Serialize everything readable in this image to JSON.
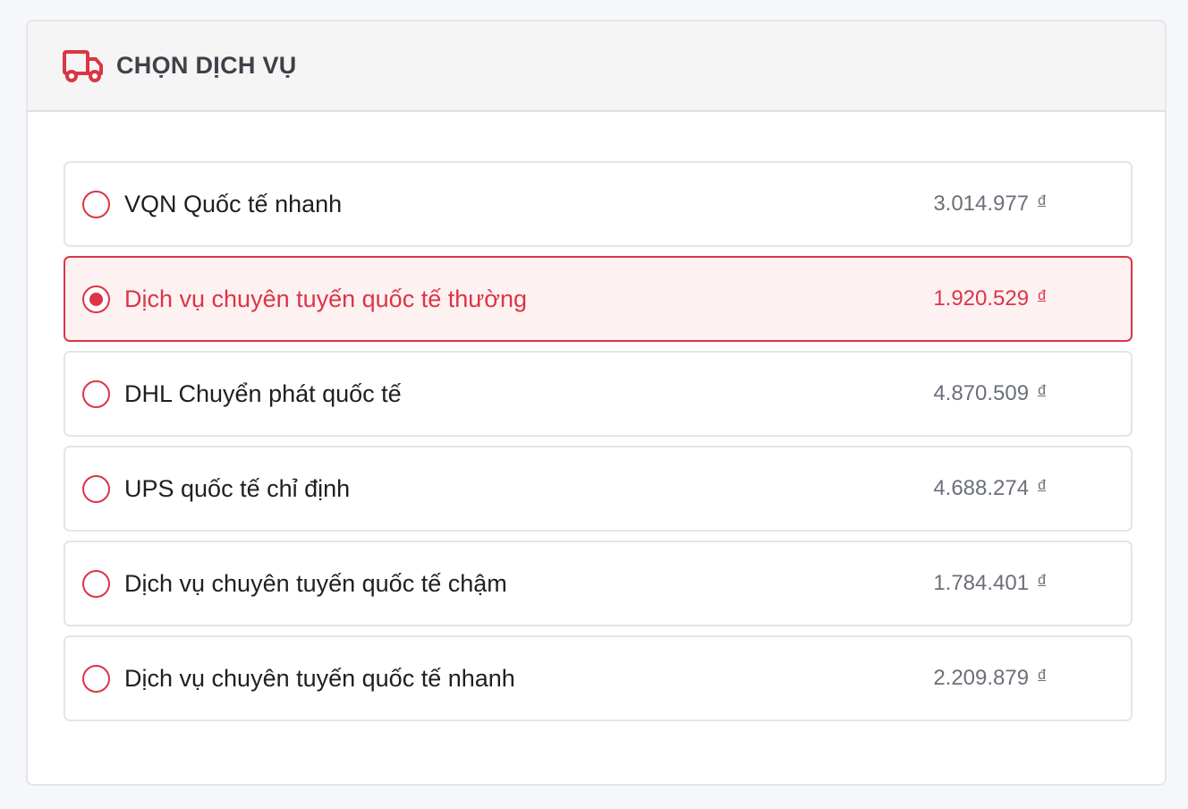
{
  "header": {
    "icon": "truck-icon",
    "title": "CHỌN DỊCH VỤ"
  },
  "colors": {
    "accent": "#dc3545",
    "selected_bg": "#fdf1f2"
  },
  "options": [
    {
      "label": "VQN Quốc tế nhanh",
      "price": "3.014.977",
      "currency": "đ",
      "selected": false
    },
    {
      "label": "Dịch vụ chuyên tuyến quốc tế thường",
      "price": "1.920.529",
      "currency": "đ",
      "selected": true
    },
    {
      "label": "DHL Chuyển phát quốc tế",
      "price": "4.870.509",
      "currency": "đ",
      "selected": false
    },
    {
      "label": "UPS quốc tế chỉ định",
      "price": "4.688.274",
      "currency": "đ",
      "selected": false
    },
    {
      "label": "Dịch vụ chuyên tuyến quốc tế chậm",
      "price": "1.784.401",
      "currency": "đ",
      "selected": false
    },
    {
      "label": "Dịch vụ chuyên tuyến quốc tế nhanh",
      "price": "2.209.879",
      "currency": "đ",
      "selected": false
    }
  ]
}
